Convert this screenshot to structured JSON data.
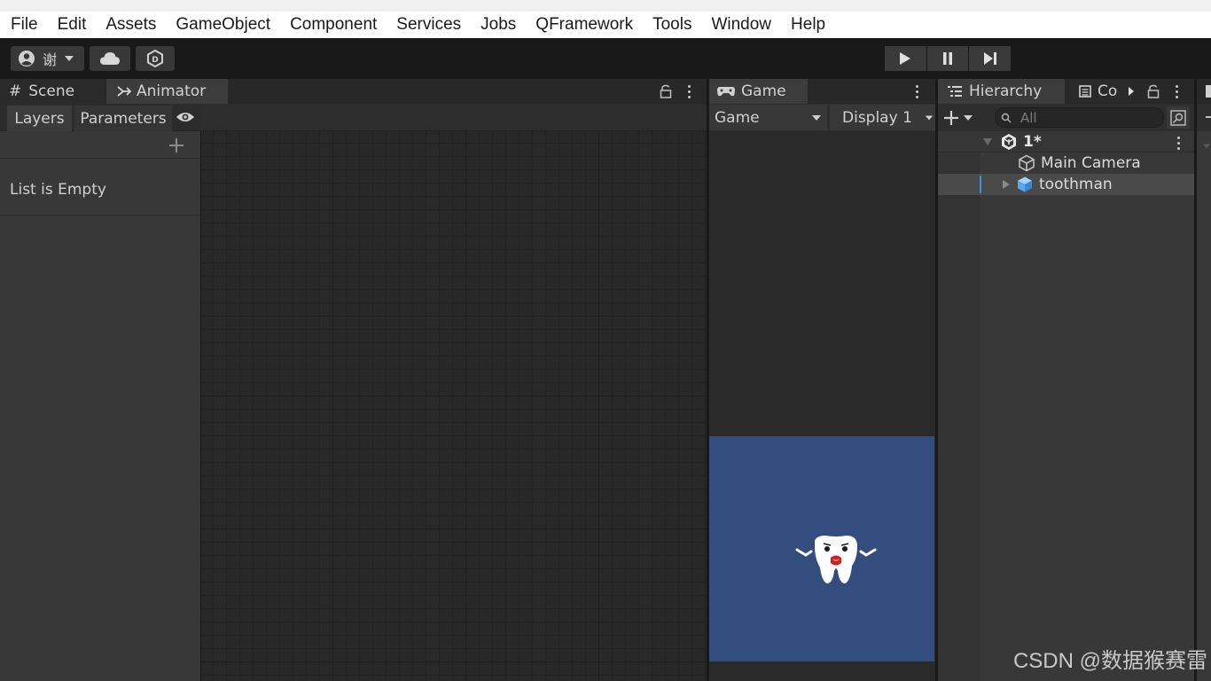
{
  "menu": [
    "File",
    "Edit",
    "Assets",
    "GameObject",
    "Component",
    "Services",
    "Jobs",
    "QFramework",
    "Tools",
    "Window",
    "Help"
  ],
  "toolbar": {
    "account_name": "谢"
  },
  "left_tabs": {
    "scene": "Scene",
    "animator": "Animator"
  },
  "animator": {
    "layers_tab": "Layers",
    "parameters_tab": "Parameters",
    "empty_text": "List is Empty"
  },
  "game": {
    "tab": "Game",
    "mode": "Game",
    "display": "Display 1",
    "background": "#334e7e"
  },
  "hierarchy": {
    "tab": "Hierarchy",
    "console_tab": "Co",
    "search_placeholder": "All",
    "scene_name": "1*",
    "items": [
      {
        "label": "Main Camera",
        "icon": "gameobject-icon"
      },
      {
        "label": "toothman",
        "icon": "prefab-icon"
      }
    ]
  },
  "watermark": "CSDN @数据猴赛雷"
}
